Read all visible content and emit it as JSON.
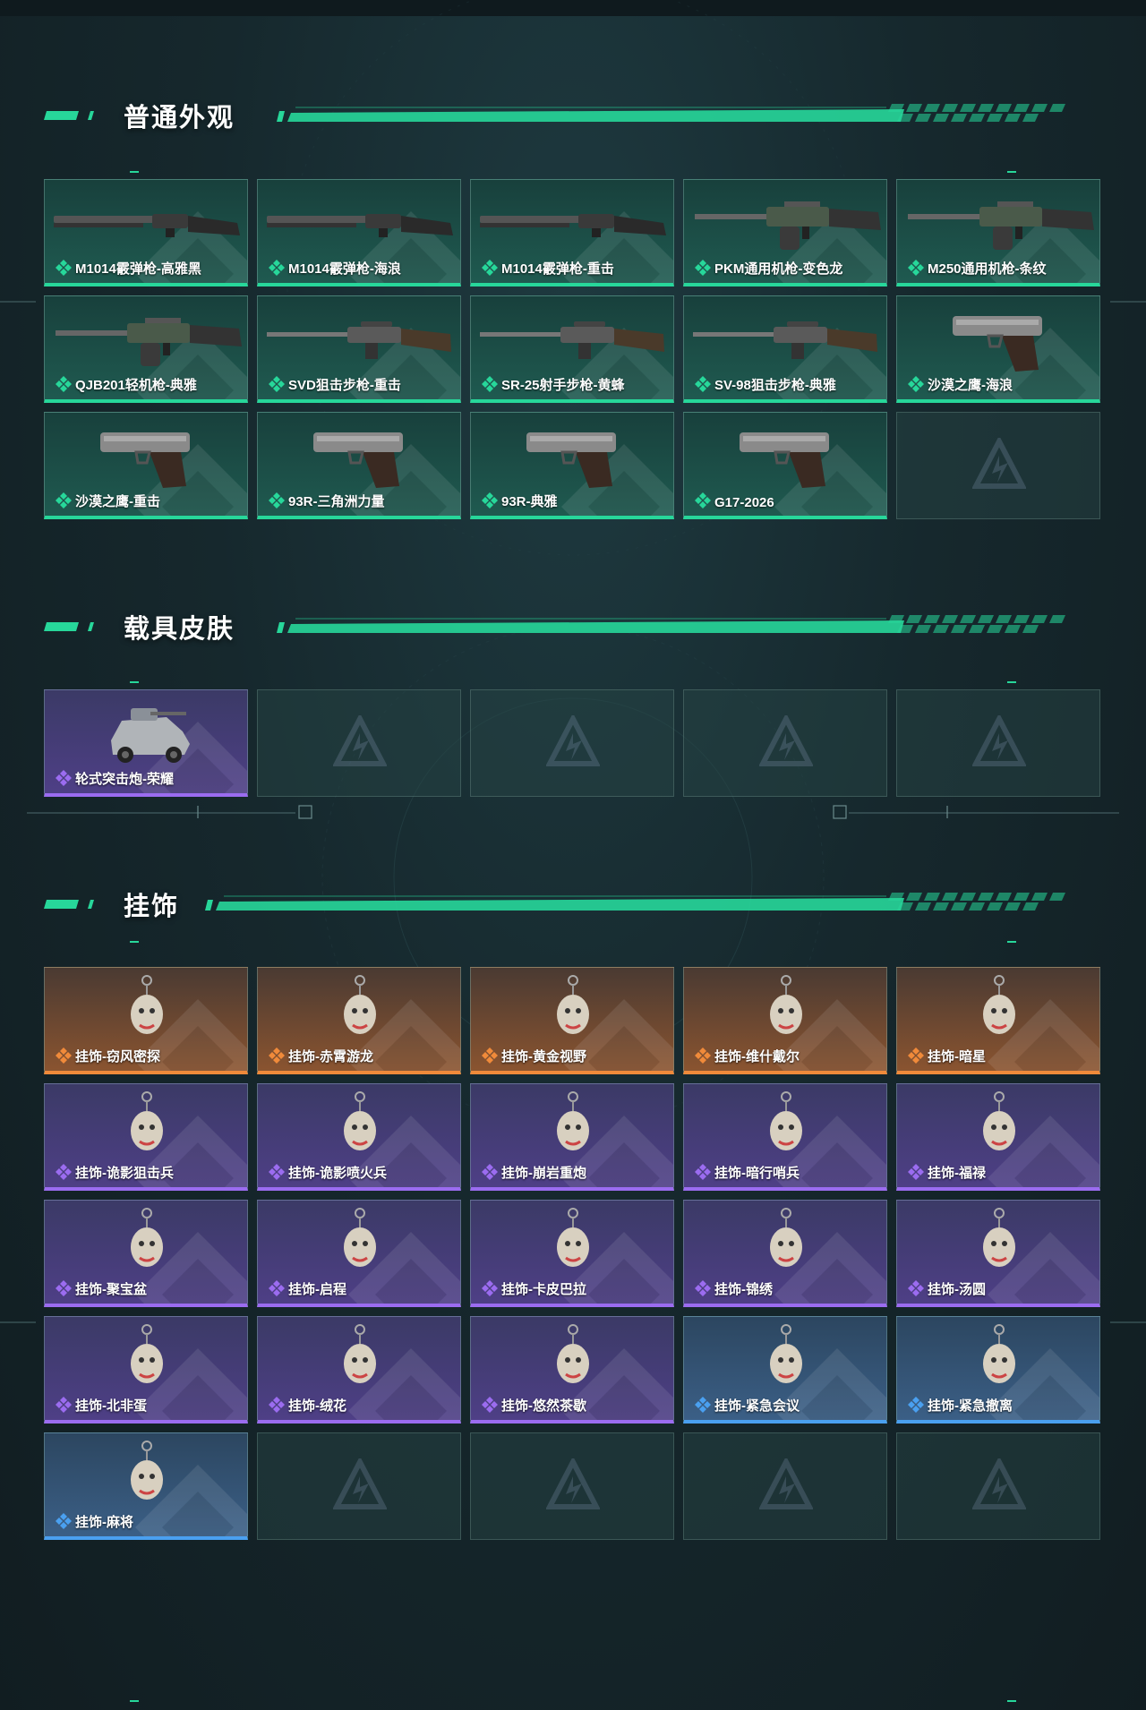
{
  "sections": [
    {
      "title": "普通外观",
      "items": [
        {
          "label": "M1014霰弹枪-高雅黑",
          "rarity": "green",
          "icon": "shotgun-icon"
        },
        {
          "label": "M1014霰弹枪-海浪",
          "rarity": "green",
          "icon": "shotgun-icon"
        },
        {
          "label": "M1014霰弹枪-重击",
          "rarity": "green",
          "icon": "shotgun-icon"
        },
        {
          "label": "PKM通用机枪-变色龙",
          "rarity": "green",
          "icon": "machine-gun-icon"
        },
        {
          "label": "M250通用机枪-条纹",
          "rarity": "green",
          "icon": "machine-gun-icon"
        },
        {
          "label": "QJB201轻机枪-典雅",
          "rarity": "green",
          "icon": "machine-gun-icon"
        },
        {
          "label": "SVD狙击步枪-重击",
          "rarity": "green",
          "icon": "rifle-icon"
        },
        {
          "label": "SR-25射手步枪-黄蜂",
          "rarity": "green",
          "icon": "rifle-icon"
        },
        {
          "label": "SV-98狙击步枪-典雅",
          "rarity": "green",
          "icon": "rifle-icon"
        },
        {
          "label": "沙漠之鹰-海浪",
          "rarity": "green",
          "icon": "pistol-icon"
        },
        {
          "label": "沙漠之鹰-重击",
          "rarity": "green",
          "icon": "pistol-icon"
        },
        {
          "label": "93R-三角洲力量",
          "rarity": "green",
          "icon": "pistol-icon"
        },
        {
          "label": "93R-典雅",
          "rarity": "green",
          "icon": "pistol-icon"
        },
        {
          "label": "G17-2026",
          "rarity": "green",
          "icon": "pistol-icon"
        }
      ],
      "empty_slots": 1
    },
    {
      "title": "载具皮肤",
      "items": [
        {
          "label": "轮式突击炮-荣耀",
          "rarity": "purple",
          "icon": "vehicle-icon"
        }
      ],
      "empty_slots": 4
    },
    {
      "title": "挂饰",
      "items": [
        {
          "label": "挂饰-窃风密探",
          "rarity": "orange",
          "icon": "charm-icon"
        },
        {
          "label": "挂饰-赤霄游龙",
          "rarity": "orange",
          "icon": "charm-icon"
        },
        {
          "label": "挂饰-黄金视野",
          "rarity": "orange",
          "icon": "charm-icon"
        },
        {
          "label": "挂饰-维什戴尔",
          "rarity": "orange",
          "icon": "charm-icon"
        },
        {
          "label": "挂饰-暗星",
          "rarity": "orange",
          "icon": "charm-icon"
        },
        {
          "label": "挂饰-诡影狙击兵",
          "rarity": "purple",
          "icon": "charm-icon"
        },
        {
          "label": "挂饰-诡影喷火兵",
          "rarity": "purple",
          "icon": "charm-icon"
        },
        {
          "label": "挂饰-崩岩重炮",
          "rarity": "purple",
          "icon": "charm-icon"
        },
        {
          "label": "挂饰-暗行哨兵",
          "rarity": "purple",
          "icon": "charm-icon"
        },
        {
          "label": "挂饰-福禄",
          "rarity": "purple",
          "icon": "charm-icon"
        },
        {
          "label": "挂饰-聚宝盆",
          "rarity": "purple",
          "icon": "charm-icon"
        },
        {
          "label": "挂饰-启程",
          "rarity": "purple",
          "icon": "charm-icon"
        },
        {
          "label": "挂饰-卡皮巴拉",
          "rarity": "purple",
          "icon": "charm-icon"
        },
        {
          "label": "挂饰-锦绣",
          "rarity": "purple",
          "icon": "charm-icon"
        },
        {
          "label": "挂饰-汤圆",
          "rarity": "purple",
          "icon": "charm-icon"
        },
        {
          "label": "挂饰-北非蛋",
          "rarity": "purple",
          "icon": "charm-icon"
        },
        {
          "label": "挂饰-绒花",
          "rarity": "purple",
          "icon": "charm-icon"
        },
        {
          "label": "挂饰-悠然茶歇",
          "rarity": "purple",
          "icon": "charm-icon"
        },
        {
          "label": "挂饰-紧急会议",
          "rarity": "blue",
          "icon": "charm-icon"
        },
        {
          "label": "挂饰-紧急撤离",
          "rarity": "blue",
          "icon": "charm-icon"
        },
        {
          "label": "挂饰-麻将",
          "rarity": "blue",
          "icon": "charm-icon"
        }
      ],
      "empty_slots": 4
    }
  ],
  "colors": {
    "accent": "#27d79a",
    "green": "#27d79a",
    "purple": "#9b6cf0",
    "orange": "#f08a3a",
    "blue": "#4aa0f0"
  }
}
